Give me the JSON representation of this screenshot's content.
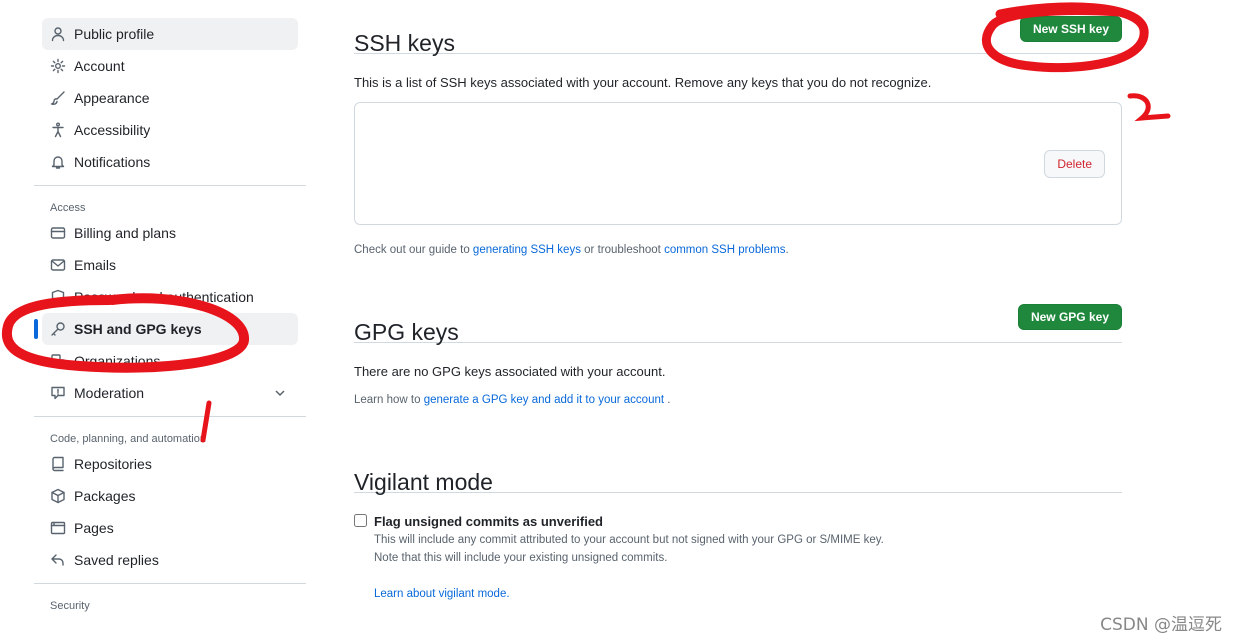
{
  "sidebar": {
    "items": [
      {
        "label": "Public profile"
      },
      {
        "label": "Account"
      },
      {
        "label": "Appearance"
      },
      {
        "label": "Accessibility"
      },
      {
        "label": "Notifications"
      }
    ],
    "access_heading": "Access",
    "access_items": [
      {
        "label": "Billing and plans"
      },
      {
        "label": "Emails"
      },
      {
        "label": "Password and authentication"
      },
      {
        "label": "SSH and GPG keys"
      },
      {
        "label": "Organizations"
      },
      {
        "label": "Moderation"
      }
    ],
    "code_heading": "Code, planning, and automation",
    "code_items": [
      {
        "label": "Repositories"
      },
      {
        "label": "Packages"
      },
      {
        "label": "Pages"
      },
      {
        "label": "Saved replies"
      }
    ],
    "security_heading": "Security"
  },
  "ssh": {
    "title": "SSH keys",
    "new_button": "New SSH key",
    "description": "This is a list of SSH keys associated with your account. Remove any keys that you do not recognize.",
    "delete_button": "Delete",
    "guide_prefix": "Check out our guide to ",
    "guide_link1": "generating SSH keys",
    "guide_mid": " or troubleshoot ",
    "guide_link2": "common SSH problems",
    "guide_suffix": "."
  },
  "gpg": {
    "title": "GPG keys",
    "new_button": "New GPG key",
    "empty": "There are no GPG keys associated with your account.",
    "learn_prefix": "Learn how to ",
    "learn_link": "generate a GPG key and add it to your account",
    "learn_suffix": " ."
  },
  "vigilant": {
    "title": "Vigilant mode",
    "checkbox_label": "Flag unsigned commits as unverified",
    "desc1": "This will include any commit attributed to your account but not signed with your GPG or S/MIME key.",
    "desc2": "Note that this will include your existing unsigned commits.",
    "learn_link": "Learn about vigilant mode."
  },
  "watermark": "CSDN @温逗死",
  "colors": {
    "accent": "#0969da",
    "primary_button": "#1f883d",
    "annotation": "#e8141b"
  }
}
